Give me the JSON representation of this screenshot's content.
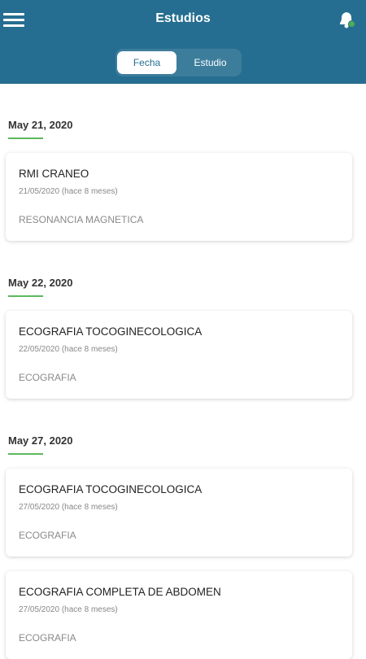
{
  "header": {
    "title": "Estudios",
    "accent_color": "#266e91",
    "notification_dot_color": "#4caf50"
  },
  "tabs": [
    {
      "label": "Fecha",
      "active": true
    },
    {
      "label": "Estudio",
      "active": false
    }
  ],
  "groups": [
    {
      "date": "May 21, 2020",
      "studies": [
        {
          "name": "RMI CRANEO",
          "subtitle": "21/05/2020 (hace 8 meses)",
          "type": "RESONANCIA MAGNETICA"
        }
      ]
    },
    {
      "date": "May 22, 2020",
      "studies": [
        {
          "name": "ECOGRAFIA TOCOGINECOLOGICA",
          "subtitle": "22/05/2020 (hace 8 meses)",
          "type": "ECOGRAFIA"
        }
      ]
    },
    {
      "date": "May 27, 2020",
      "studies": [
        {
          "name": "ECOGRAFIA TOCOGINECOLOGICA",
          "subtitle": "27/05/2020 (hace 8 meses)",
          "type": "ECOGRAFIA"
        },
        {
          "name": "ECOGRAFIA COMPLETA DE ABDOMEN",
          "subtitle": "27/05/2020 (hace 8 meses)",
          "type": "ECOGRAFIA"
        }
      ]
    }
  ]
}
